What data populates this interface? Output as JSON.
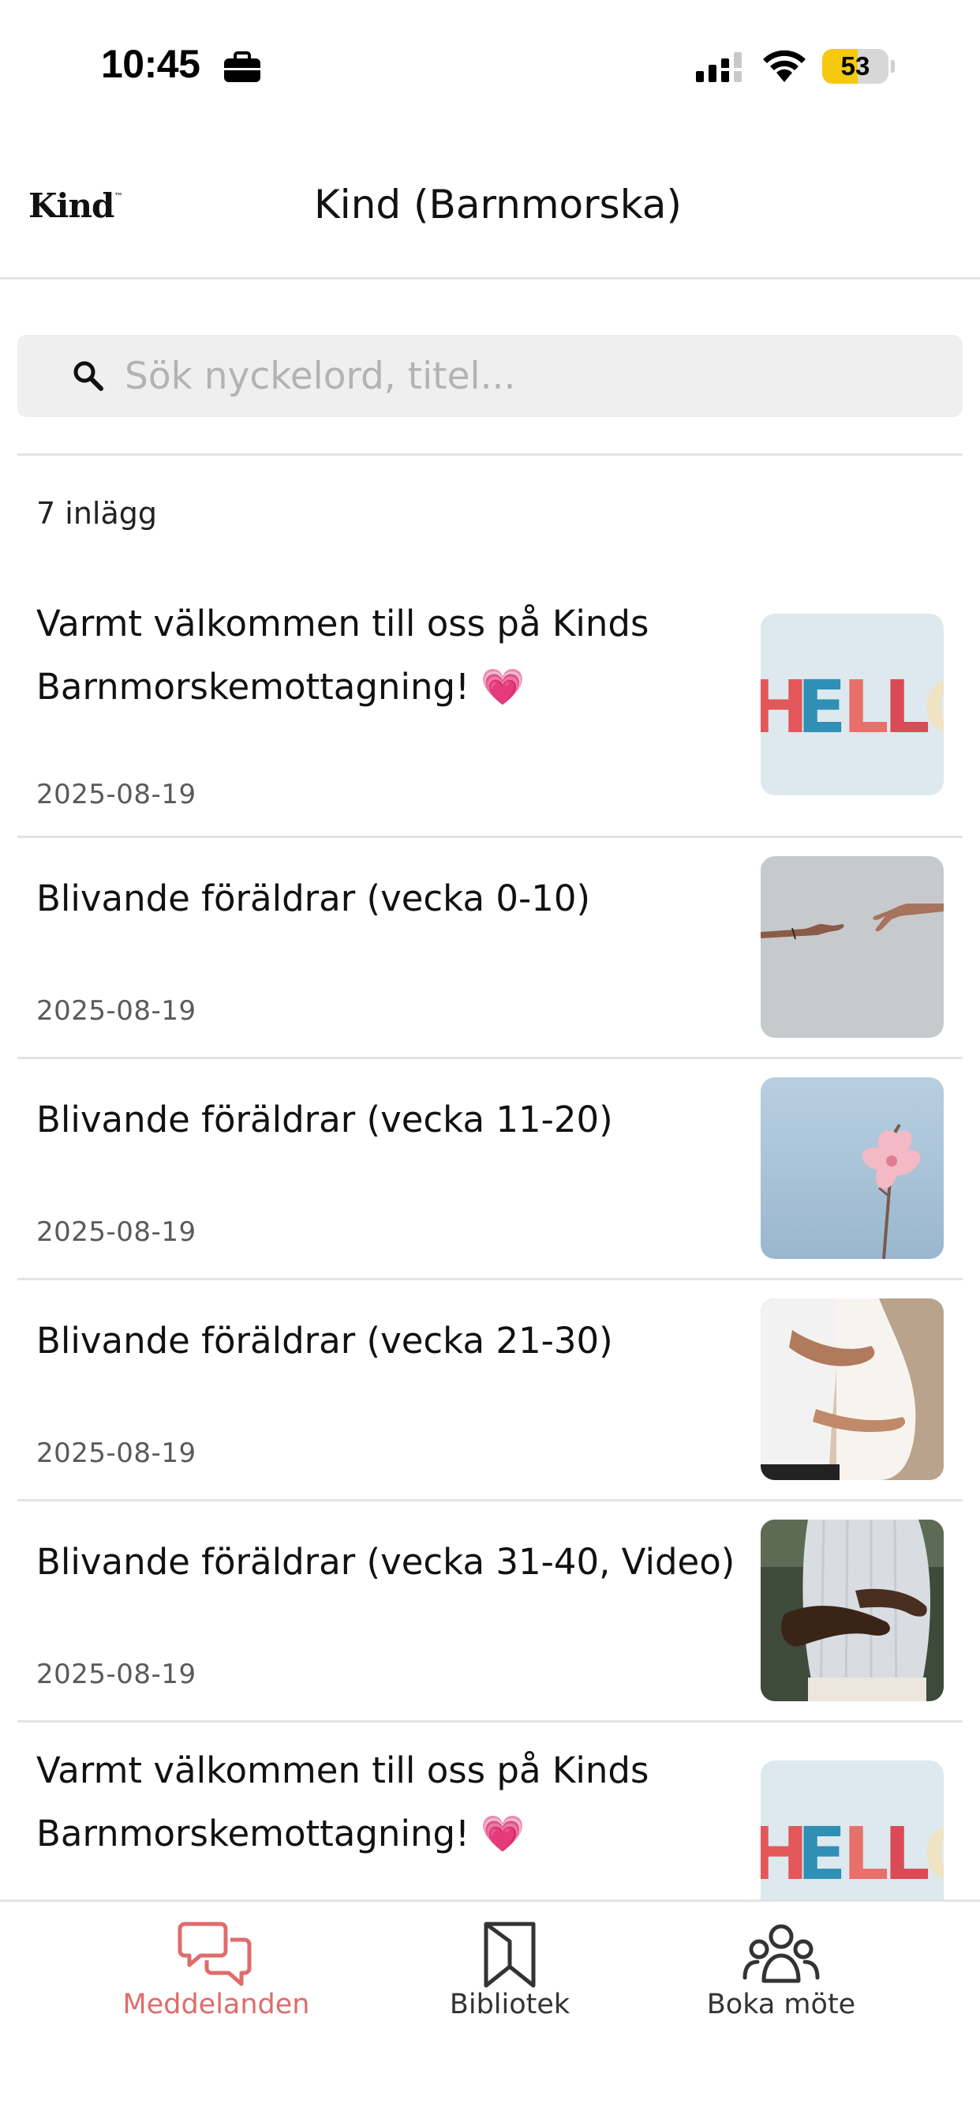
{
  "status_bar": {
    "time": "10:45",
    "battery_percent": 53,
    "battery_label": "53",
    "icons": [
      "briefcase-icon",
      "cellular-signal-icon",
      "wifi-icon",
      "battery-icon"
    ]
  },
  "header": {
    "logo_text": "Kind",
    "logo_mark": "™",
    "title": "Kind (Barnmorska)"
  },
  "search": {
    "placeholder": "Sök nyckelord, titel...",
    "value": "",
    "icon": "search-icon"
  },
  "post_count": "7 inlägg",
  "posts": [
    {
      "title": "Varmt välkommen till oss på Kinds Barnmorskemottagning! 💗",
      "date": "2025-08-19",
      "thumbnail": "hello-letters-image"
    },
    {
      "title": "Blivande föräldrar (vecka 0-10)",
      "date": "2025-08-19",
      "thumbnail": "reaching-hands-image"
    },
    {
      "title": "Blivande föräldrar (vecka 11-20)",
      "date": "2025-08-19",
      "thumbnail": "pink-flower-sky-image"
    },
    {
      "title": "Blivande föräldrar (vecka 21-30)",
      "date": "2025-08-19",
      "thumbnail": "couple-pregnancy-image"
    },
    {
      "title": "Blivande föräldrar (vecka 31-40, Video)",
      "date": "2025-08-19",
      "thumbnail": "hands-on-belly-image"
    },
    {
      "title": "Varmt välkommen till oss på Kinds Barnmorskemottagning! 💗",
      "date": "",
      "thumbnail": "hello-letters-image"
    }
  ],
  "tab_bar": {
    "tabs": [
      {
        "label": "Meddelanden",
        "icon": "chat-bubbles-icon",
        "active": true
      },
      {
        "label": "Bibliotek",
        "icon": "bookmark-book-icon",
        "active": false
      },
      {
        "label": "Boka möte",
        "icon": "group-people-icon",
        "active": false
      }
    ]
  },
  "colors": {
    "accent": "#e06b6b",
    "divider": "#e3e3e3",
    "search_bg": "#efefef",
    "battery_fill": "#f6c90e"
  }
}
